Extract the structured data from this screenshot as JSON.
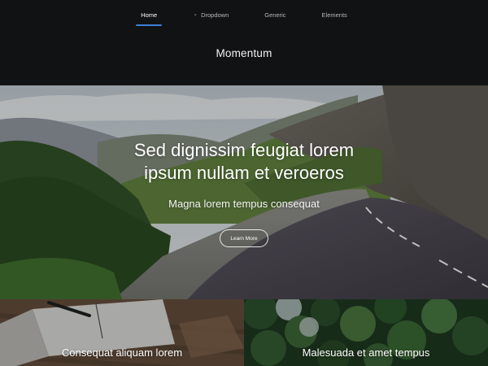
{
  "nav": {
    "items": [
      {
        "label": "Home",
        "active": true,
        "icon": ""
      },
      {
        "label": "Dropdown",
        "active": false,
        "icon": "chevron-down-icon"
      },
      {
        "label": "Generic",
        "active": false,
        "icon": ""
      },
      {
        "label": "Elements",
        "active": false,
        "icon": ""
      }
    ],
    "accent": "#3b7fd9"
  },
  "site": {
    "title": "Momentum"
  },
  "hero": {
    "heading_line1": "Sed dignissim feugiat lorem",
    "heading_line2": "ipsum nullam et veroeros",
    "subtitle": "Magna lorem tempus consequat",
    "button_label": "Learn More",
    "image": "mountain-road-photo"
  },
  "tiles": [
    {
      "label": "Consequat aliquam lorem",
      "image": "notebook-desk-photo"
    },
    {
      "label": "Malesuada et amet tempus",
      "image": "forest-aerial-photo"
    }
  ]
}
